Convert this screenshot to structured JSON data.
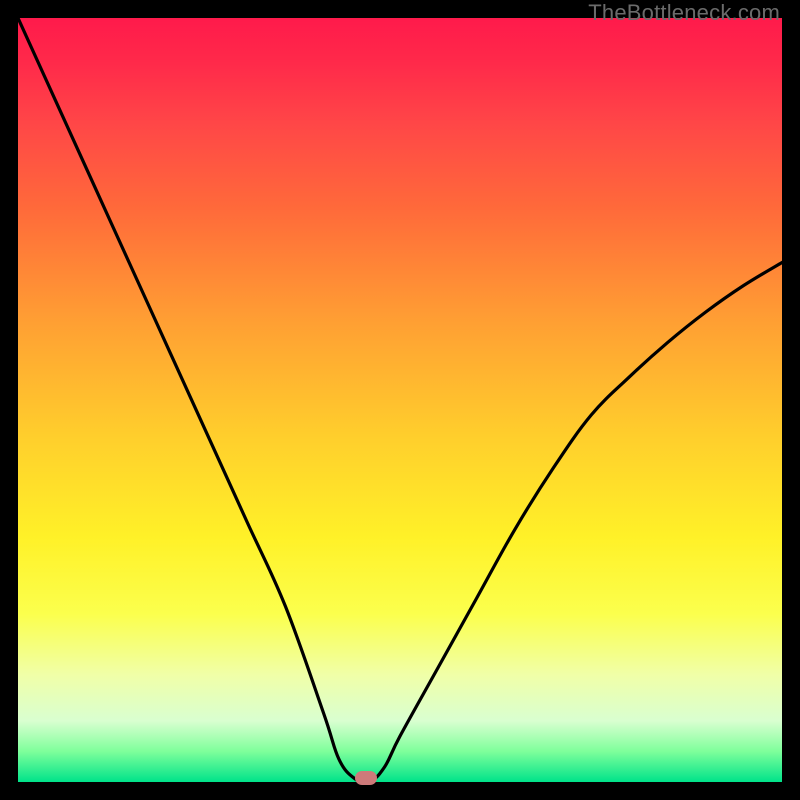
{
  "watermark": "TheBottleneck.com",
  "marker": {
    "x_frac": 0.455,
    "y_frac": 0.995
  },
  "chart_data": {
    "type": "line",
    "title": "",
    "xlabel": "",
    "ylabel": "",
    "xlim": [
      0,
      100
    ],
    "ylim": [
      0,
      100
    ],
    "x": [
      0,
      5,
      10,
      15,
      20,
      25,
      30,
      35,
      40,
      42,
      44,
      46,
      48,
      50,
      55,
      60,
      65,
      70,
      75,
      80,
      85,
      90,
      95,
      100
    ],
    "values": [
      100,
      89,
      78,
      67,
      56,
      45,
      34,
      23,
      9,
      3,
      0.5,
      0,
      2,
      6,
      15,
      24,
      33,
      41,
      48,
      53,
      57.5,
      61.5,
      65,
      68
    ],
    "minimum_at_x": 46,
    "grid": false,
    "legend": false,
    "note": "Values indicate distance from bottom (0) to top (100). Curve drops steeply from upper-left to a minimum near x≈46, then rises gradually toward upper-right with slight flattening."
  }
}
